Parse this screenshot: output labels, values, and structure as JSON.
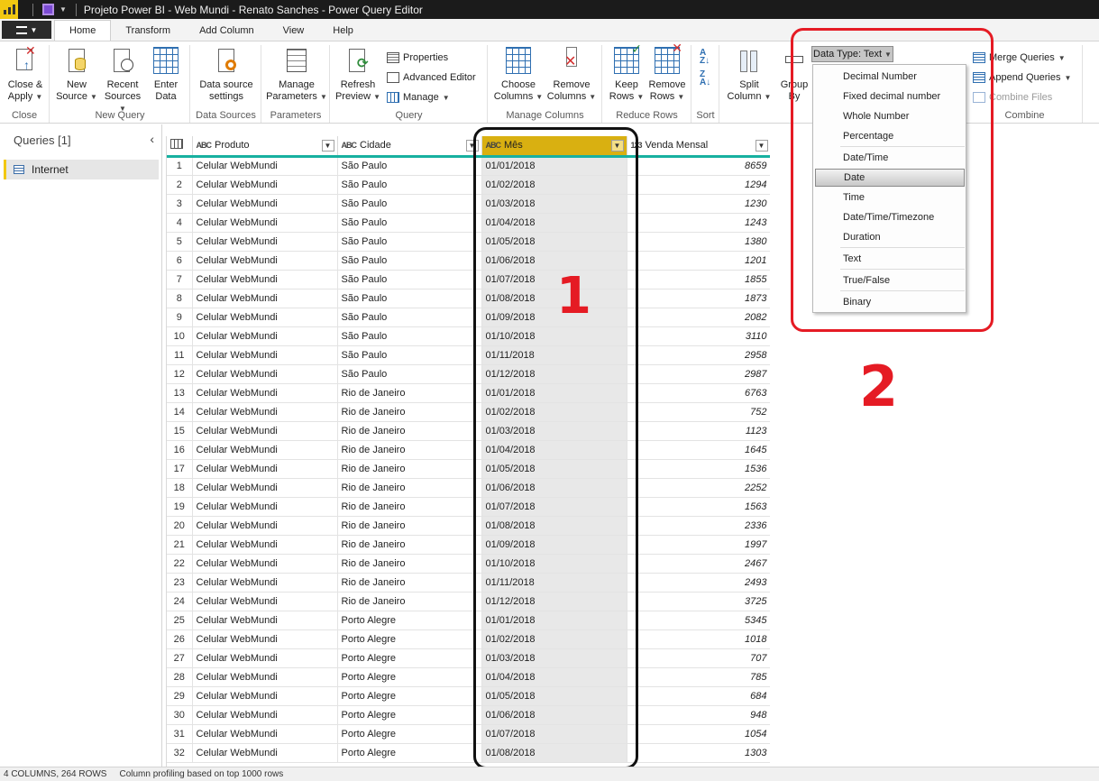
{
  "window": {
    "title": "Projeto Power BI - Web Mundi - Renato Sanches - Power Query Editor"
  },
  "tabs": [
    {
      "label": "Home"
    },
    {
      "label": "Transform"
    },
    {
      "label": "Add Column"
    },
    {
      "label": "View"
    },
    {
      "label": "Help"
    }
  ],
  "ribbon": {
    "close_group": {
      "btn": "Close & Apply",
      "btn_l1": "Close &",
      "btn_l2": "Apply",
      "label": "Close"
    },
    "new_query_group": {
      "new_source_l1": "New",
      "new_source_l2": "Source",
      "recent_l1": "Recent",
      "recent_l2": "Sources",
      "enter_l1": "Enter",
      "enter_l2": "Data",
      "label": "New Query"
    },
    "data_sources_group": {
      "btn_l1": "Data source",
      "btn_l2": "settings",
      "label": "Data Sources"
    },
    "parameters_group": {
      "btn_l1": "Manage",
      "btn_l2": "Parameters",
      "label": "Parameters"
    },
    "query_group": {
      "refresh_l1": "Refresh",
      "refresh_l2": "Preview",
      "properties": "Properties",
      "advanced_editor": "Advanced Editor",
      "manage": "Manage",
      "label": "Query"
    },
    "manage_columns_group": {
      "choose_l1": "Choose",
      "choose_l2": "Columns",
      "remove_l1": "Remove",
      "remove_l2": "Columns",
      "label": "Manage Columns"
    },
    "reduce_rows_group": {
      "keep_l1": "Keep",
      "keep_l2": "Rows",
      "remove_l1": "Remove",
      "remove_l2": "Rows",
      "label": "Reduce Rows"
    },
    "sort_group": {
      "label": "Sort"
    },
    "transform_group": {
      "split_l1": "Split",
      "split_l2": "Column",
      "group_l1": "Group",
      "group_l2": "By"
    },
    "data_type_button": "Data Type: Text",
    "combine_group": {
      "merge": "Merge Queries",
      "append": "Append Queries",
      "combine_files": "Combine Files",
      "label": "Combine"
    }
  },
  "data_type_menu": {
    "items": [
      "Decimal Number",
      "Fixed decimal number",
      "Whole Number",
      "Percentage",
      "Date/Time",
      "Date",
      "Time",
      "Date/Time/Timezone",
      "Duration",
      "Text",
      "True/False",
      "Binary"
    ],
    "highlighted": "Date"
  },
  "left_pane": {
    "title": "Queries [1]",
    "items": [
      {
        "label": "Internet"
      }
    ]
  },
  "grid": {
    "type_icons": {
      "text": "ABC",
      "number": "123"
    },
    "columns": [
      "Produto",
      "Cidade",
      "Mês",
      "Venda Mensal"
    ],
    "rows": [
      [
        "1",
        "Celular WebMundi",
        "São Paulo",
        "01/01/2018",
        "8659"
      ],
      [
        "2",
        "Celular WebMundi",
        "São Paulo",
        "01/02/2018",
        "1294"
      ],
      [
        "3",
        "Celular WebMundi",
        "São Paulo",
        "01/03/2018",
        "1230"
      ],
      [
        "4",
        "Celular WebMundi",
        "São Paulo",
        "01/04/2018",
        "1243"
      ],
      [
        "5",
        "Celular WebMundi",
        "São Paulo",
        "01/05/2018",
        "1380"
      ],
      [
        "6",
        "Celular WebMundi",
        "São Paulo",
        "01/06/2018",
        "1201"
      ],
      [
        "7",
        "Celular WebMundi",
        "São Paulo",
        "01/07/2018",
        "1855"
      ],
      [
        "8",
        "Celular WebMundi",
        "São Paulo",
        "01/08/2018",
        "1873"
      ],
      [
        "9",
        "Celular WebMundi",
        "São Paulo",
        "01/09/2018",
        "2082"
      ],
      [
        "10",
        "Celular WebMundi",
        "São Paulo",
        "01/10/2018",
        "3110"
      ],
      [
        "11",
        "Celular WebMundi",
        "São Paulo",
        "01/11/2018",
        "2958"
      ],
      [
        "12",
        "Celular WebMundi",
        "São Paulo",
        "01/12/2018",
        "2987"
      ],
      [
        "13",
        "Celular WebMundi",
        "Rio de Janeiro",
        "01/01/2018",
        "6763"
      ],
      [
        "14",
        "Celular WebMundi",
        "Rio de Janeiro",
        "01/02/2018",
        "752"
      ],
      [
        "15",
        "Celular WebMundi",
        "Rio de Janeiro",
        "01/03/2018",
        "1123"
      ],
      [
        "16",
        "Celular WebMundi",
        "Rio de Janeiro",
        "01/04/2018",
        "1645"
      ],
      [
        "17",
        "Celular WebMundi",
        "Rio de Janeiro",
        "01/05/2018",
        "1536"
      ],
      [
        "18",
        "Celular WebMundi",
        "Rio de Janeiro",
        "01/06/2018",
        "2252"
      ],
      [
        "19",
        "Celular WebMundi",
        "Rio de Janeiro",
        "01/07/2018",
        "1563"
      ],
      [
        "20",
        "Celular WebMundi",
        "Rio de Janeiro",
        "01/08/2018",
        "2336"
      ],
      [
        "21",
        "Celular WebMundi",
        "Rio de Janeiro",
        "01/09/2018",
        "1997"
      ],
      [
        "22",
        "Celular WebMundi",
        "Rio de Janeiro",
        "01/10/2018",
        "2467"
      ],
      [
        "23",
        "Celular WebMundi",
        "Rio de Janeiro",
        "01/11/2018",
        "2493"
      ],
      [
        "24",
        "Celular WebMundi",
        "Rio de Janeiro",
        "01/12/2018",
        "3725"
      ],
      [
        "25",
        "Celular WebMundi",
        "Porto Alegre",
        "01/01/2018",
        "5345"
      ],
      [
        "26",
        "Celular WebMundi",
        "Porto Alegre",
        "01/02/2018",
        "1018"
      ],
      [
        "27",
        "Celular WebMundi",
        "Porto Alegre",
        "01/03/2018",
        "707"
      ],
      [
        "28",
        "Celular WebMundi",
        "Porto Alegre",
        "01/04/2018",
        "785"
      ],
      [
        "29",
        "Celular WebMundi",
        "Porto Alegre",
        "01/05/2018",
        "684"
      ],
      [
        "30",
        "Celular WebMundi",
        "Porto Alegre",
        "01/06/2018",
        "948"
      ],
      [
        "31",
        "Celular WebMundi",
        "Porto Alegre",
        "01/07/2018",
        "1054"
      ],
      [
        "32",
        "Celular WebMundi",
        "Porto Alegre",
        "01/08/2018",
        "1303"
      ]
    ]
  },
  "annotations": {
    "one": "1",
    "two": "2"
  },
  "status": {
    "columns_rows": "4 COLUMNS, 264 ROWS",
    "profiling": "Column profiling based on top 1000 rows"
  },
  "colors": {
    "accent_yellow": "#f2c811",
    "selected_header": "#d9b011",
    "header_underline": "#17b0a0",
    "annotation_red": "#e51b24"
  }
}
